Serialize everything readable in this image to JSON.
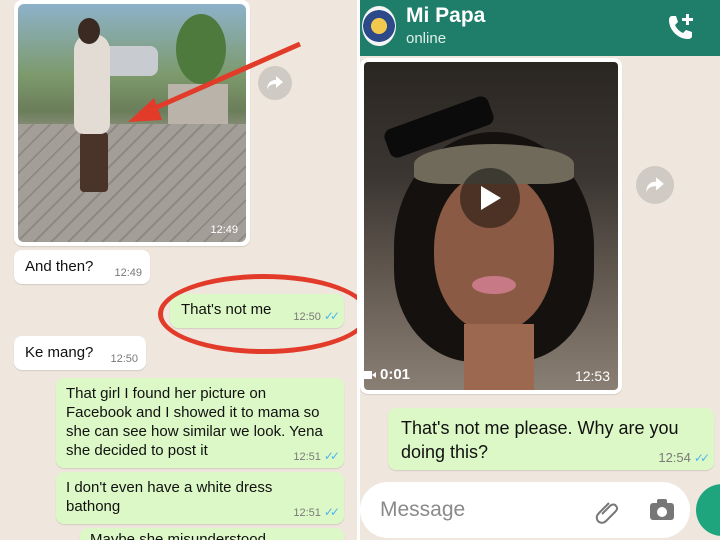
{
  "left": {
    "photo_time": "12:49",
    "messages": [
      {
        "text": "And then?",
        "time": "12:49"
      },
      {
        "text": "That's not me",
        "time": "12:50"
      },
      {
        "text": "Ke mang?",
        "time": "12:50"
      },
      {
        "text": "That girl I found her picture on Facebook and I showed it to mama so she can see how similar we look. Yena she decided to post it",
        "time": "12:51"
      },
      {
        "text": "I don't even have a white dress bathong",
        "time": "12:51"
      },
      {
        "text": "Maybe she misunderstood",
        "time": ""
      }
    ]
  },
  "right": {
    "contact_name": "Mi Papa",
    "status": "online",
    "video_duration": "0:01",
    "video_time": "12:53",
    "message": {
      "text": "That's not me please. Why are you doing this?",
      "time": "12:54"
    },
    "input_placeholder": "Message"
  },
  "colors": {
    "header": "#1e7e6a",
    "outgoing": "#dcf8c6",
    "incoming": "#ffffff",
    "annotation": "#e23b2a",
    "read_ticks": "#4fb6ec"
  }
}
